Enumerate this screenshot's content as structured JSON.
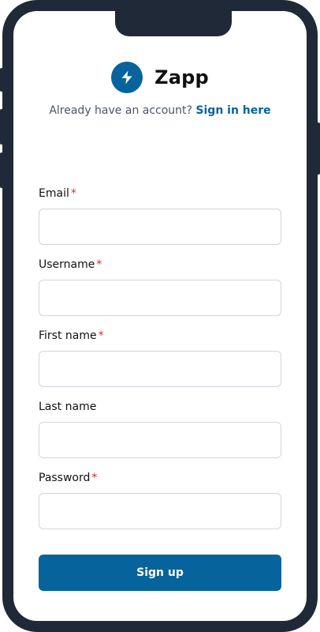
{
  "brand": {
    "name": "Zapp",
    "logo_icon": "lightning-bolt-icon",
    "accent_color": "#07639c"
  },
  "signin": {
    "prompt": "Already have an account?",
    "link_text": "Sign in here"
  },
  "form": {
    "required_marker": "*",
    "fields": [
      {
        "label": "Email",
        "required": true,
        "value": "",
        "placeholder": ""
      },
      {
        "label": "Username",
        "required": true,
        "value": "",
        "placeholder": ""
      },
      {
        "label": "First name",
        "required": true,
        "value": "",
        "placeholder": ""
      },
      {
        "label": "Last name",
        "required": false,
        "value": "",
        "placeholder": ""
      },
      {
        "label": "Password",
        "required": true,
        "value": "",
        "placeholder": ""
      }
    ],
    "submit_label": "Sign up"
  }
}
